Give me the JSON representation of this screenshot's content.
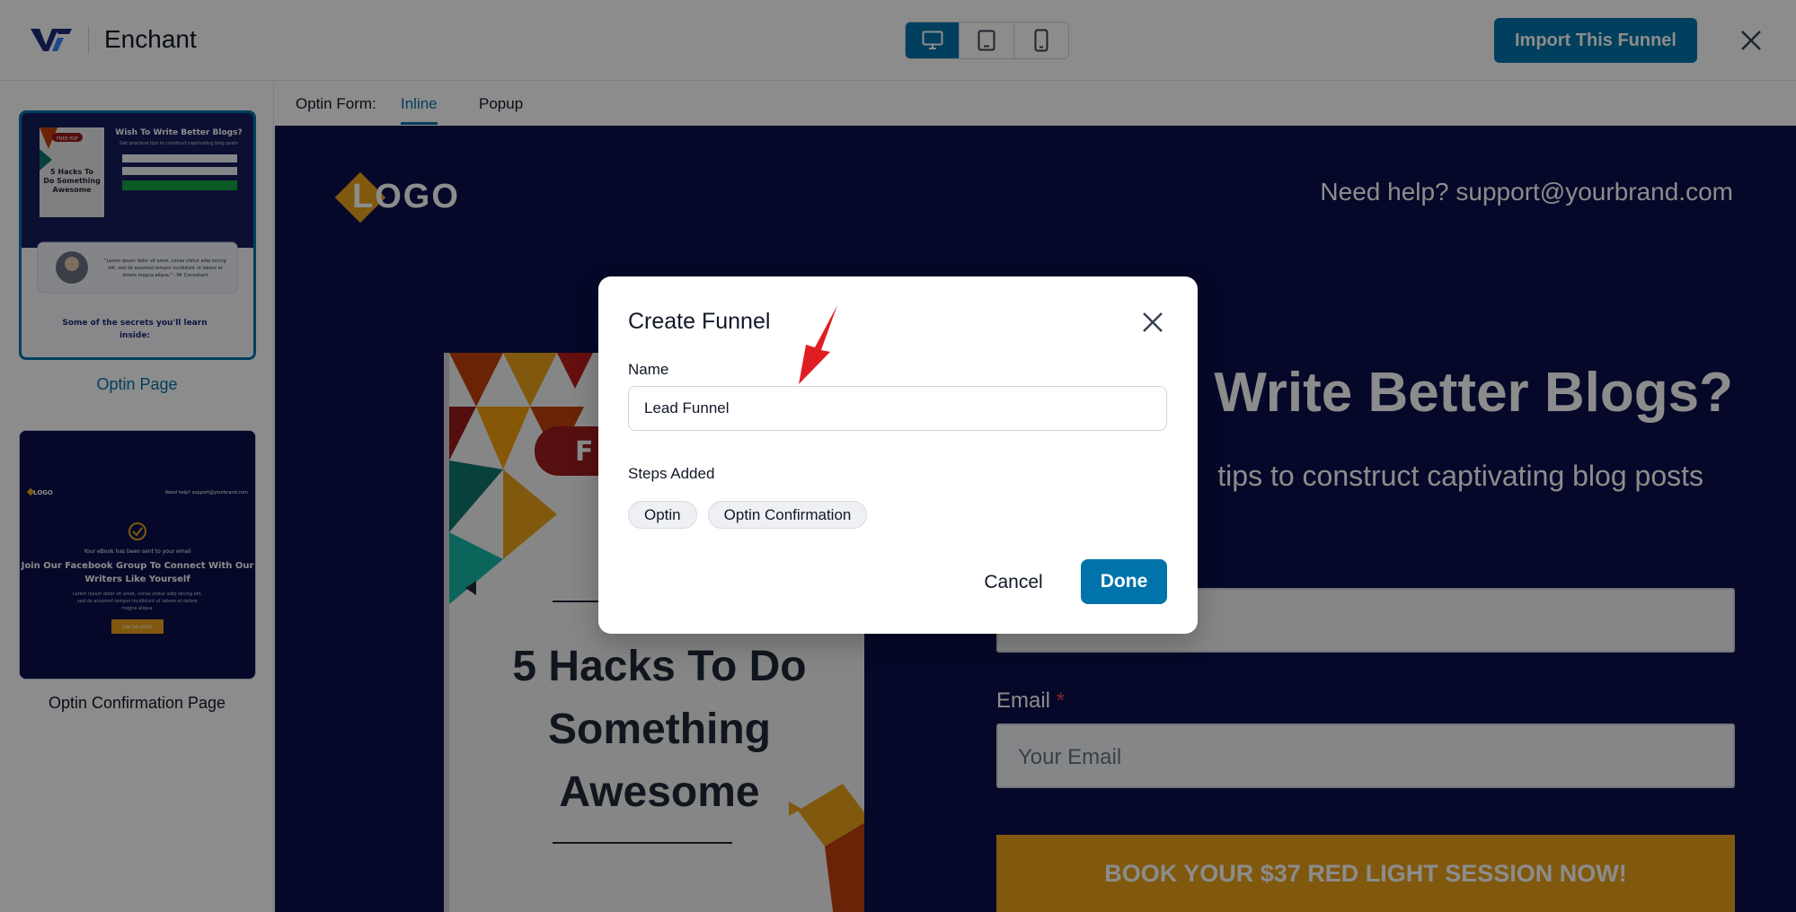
{
  "app": {
    "name": "Enchant",
    "import_button": "Import This Funnel"
  },
  "device_toggle": {
    "options": [
      "desktop-icon",
      "tablet-icon",
      "mobile-icon"
    ],
    "active": "desktop"
  },
  "sidebar": {
    "pages": [
      {
        "label": "Optin Page",
        "selected": true
      },
      {
        "label": "Optin Confirmation Page",
        "selected": false
      }
    ],
    "thumb1": {
      "heading": "Wish To Write Better Blogs?",
      "sub": "Get practical tips to construct captivating blog posts",
      "book": "5 Hacks To Do Something Awesome",
      "badge": "FREE PDF",
      "quote": "\"Lorem ipsum dolor sit amet, conse ctetur adip isicing elit, sed do eiusmod tempor incididunt ut labore et dolore magna aliqua.\" - Mr Consultant",
      "secrets": "Some of the secrets you'll learn inside:"
    },
    "thumb2": {
      "logo": "LOGO",
      "help": "Need help? support@yourbrand.com",
      "sent": "Your eBook has been sent to your email",
      "heading": "Join Our Facebook Group To Connect With Our Writers Like Yourself",
      "body": "Lorem ipsum dolor sit amet, conse ctetur adip isicing elit, sed do eiusmod tempor incididunt ut labore et dolore magna aliqua.",
      "cta": "JOIN THE GROUP"
    }
  },
  "optin": {
    "label": "Optin Form:",
    "tabs": [
      "Inline",
      "Popup"
    ],
    "active": "Inline"
  },
  "preview": {
    "logo": "LOGO",
    "help": "Need help? support@yourbrand.com",
    "headline": "o Write Better Blogs?",
    "sub": "tips to construct captivating blog posts",
    "email_label": "Email",
    "email_required": "*",
    "email_placeholder": "Your Email",
    "cta": "BOOK YOUR $37 RED LIGHT SESSION NOW!",
    "book_title": "5 Hacks To Do Something Awesome",
    "book_badge": "F"
  },
  "modal": {
    "title": "Create Funnel",
    "name_label": "Name",
    "name_value": "Lead Funnel",
    "steps_label": "Steps Added",
    "steps": [
      "Optin",
      "Optin Confirmation"
    ],
    "cancel": "Cancel",
    "done": "Done"
  },
  "colors": {
    "accent": "#0073aa",
    "preview_bg": "#0a0f4a",
    "cta": "#e9a21b",
    "arrow": "#e11d24"
  }
}
